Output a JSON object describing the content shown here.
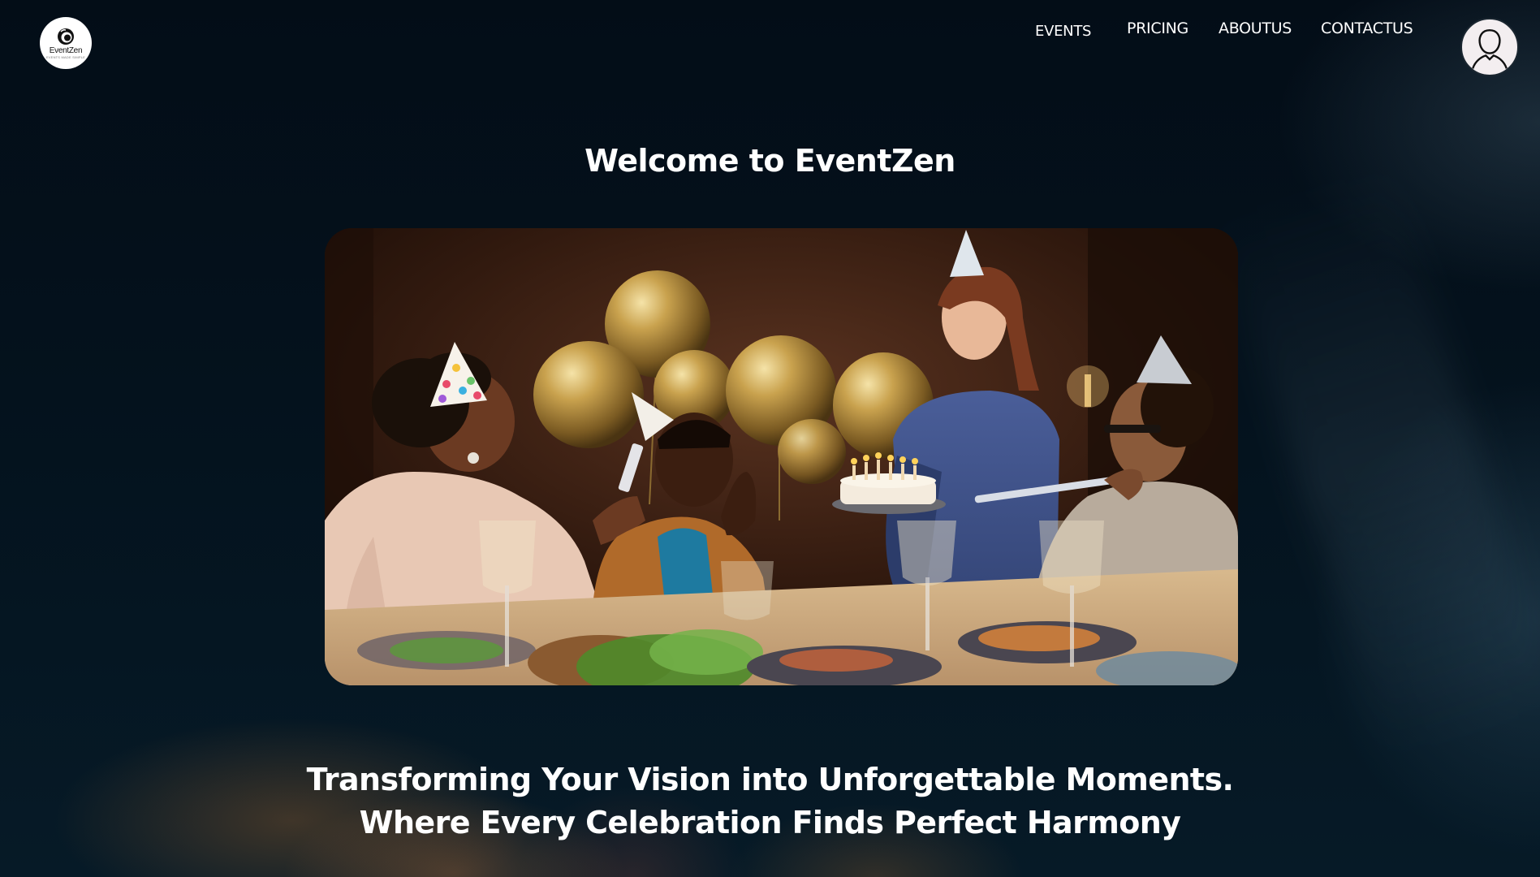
{
  "header": {
    "logo": {
      "name": "EventZen",
      "tagline": "EVENTS MADE SIMPLE"
    },
    "nav": [
      {
        "label": "EVENTS"
      },
      {
        "label": "PRICING"
      },
      {
        "label": "ABOUTUS"
      },
      {
        "label": "CONTACTUS"
      }
    ],
    "avatar_icon": "user-avatar-icon"
  },
  "main": {
    "title": "Welcome to EventZen",
    "hero_image": "birthday-party-celebration-photo",
    "tagline_lines": [
      "Transforming Your Vision into Unforgettable Moments.",
      "Where Every Celebration Finds Perfect Harmony"
    ]
  },
  "colors": {
    "background": "#04111c",
    "text": "#ffffff",
    "logo_bg": "#ffffff",
    "avatar_bg": "#f3eef0"
  }
}
